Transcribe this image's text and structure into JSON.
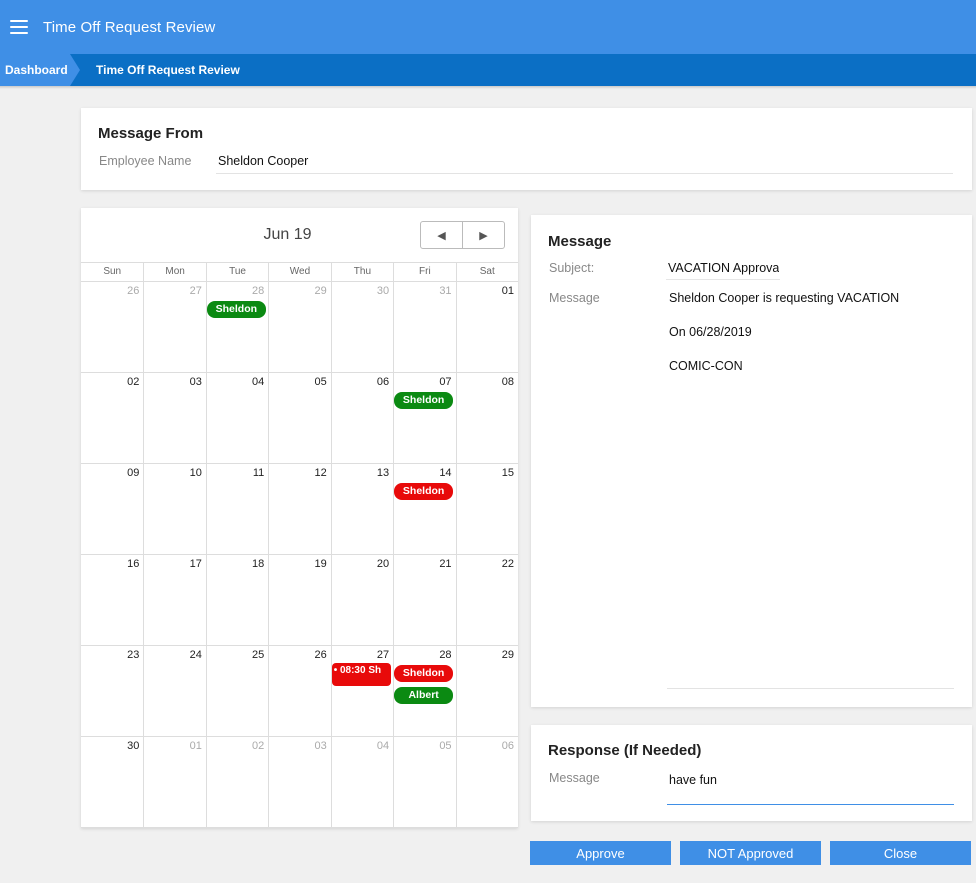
{
  "app": {
    "title": "Time Off Request Review"
  },
  "icons": {
    "menu": "hamburger-menu-icon",
    "prev": "triangle-left-icon",
    "next": "triangle-right-icon"
  },
  "colors": {
    "primary": "#3f8fe6",
    "breadcrumb": "#0b6fc5",
    "approved": "#0b8a12",
    "denied": "#e80a0a"
  },
  "breadcrumb": {
    "home": "Dashboard",
    "current": "Time Off Request Review"
  },
  "message_from": {
    "title": "Message From",
    "employee_label": "Employee Name",
    "employee_value": "Sheldon Cooper"
  },
  "calendar": {
    "title": "Jun 19",
    "weekdays": [
      "Sun",
      "Mon",
      "Tue",
      "Wed",
      "Thu",
      "Fri",
      "Sat"
    ],
    "days": [
      {
        "n": "26",
        "muted": true,
        "events": []
      },
      {
        "n": "27",
        "muted": true,
        "events": []
      },
      {
        "n": "28",
        "muted": true,
        "events": [
          {
            "label": "Sheldon",
            "color": "green"
          }
        ]
      },
      {
        "n": "29",
        "muted": true,
        "events": []
      },
      {
        "n": "30",
        "muted": true,
        "events": []
      },
      {
        "n": "31",
        "muted": true,
        "events": []
      },
      {
        "n": "01",
        "muted": false,
        "events": []
      },
      {
        "n": "02",
        "muted": false,
        "events": []
      },
      {
        "n": "03",
        "muted": false,
        "events": []
      },
      {
        "n": "04",
        "muted": false,
        "events": []
      },
      {
        "n": "05",
        "muted": false,
        "events": []
      },
      {
        "n": "06",
        "muted": false,
        "events": []
      },
      {
        "n": "07",
        "muted": false,
        "events": [
          {
            "label": "Sheldon",
            "color": "green"
          }
        ]
      },
      {
        "n": "08",
        "muted": false,
        "events": []
      },
      {
        "n": "09",
        "muted": false,
        "events": []
      },
      {
        "n": "10",
        "muted": false,
        "events": []
      },
      {
        "n": "11",
        "muted": false,
        "events": []
      },
      {
        "n": "12",
        "muted": false,
        "events": []
      },
      {
        "n": "13",
        "muted": false,
        "events": []
      },
      {
        "n": "14",
        "muted": false,
        "events": [
          {
            "label": "Sheldon",
            "color": "red"
          }
        ]
      },
      {
        "n": "15",
        "muted": false,
        "events": []
      },
      {
        "n": "16",
        "muted": false,
        "events": []
      },
      {
        "n": "17",
        "muted": false,
        "events": []
      },
      {
        "n": "18",
        "muted": false,
        "events": []
      },
      {
        "n": "19",
        "muted": false,
        "events": []
      },
      {
        "n": "20",
        "muted": false,
        "events": []
      },
      {
        "n": "21",
        "muted": false,
        "events": []
      },
      {
        "n": "22",
        "muted": false,
        "events": []
      },
      {
        "n": "23",
        "muted": false,
        "events": []
      },
      {
        "n": "24",
        "muted": false,
        "events": []
      },
      {
        "n": "25",
        "muted": false,
        "events": []
      },
      {
        "n": "26",
        "muted": false,
        "events": []
      },
      {
        "n": "27",
        "muted": false,
        "events": [
          {
            "label": "• 08:30 Sh",
            "color": "red",
            "timed": true
          }
        ]
      },
      {
        "n": "28",
        "muted": false,
        "events": [
          {
            "label": "Sheldon",
            "color": "red"
          },
          {
            "label": "Albert",
            "color": "green"
          }
        ]
      },
      {
        "n": "29",
        "muted": false,
        "events": []
      },
      {
        "n": "30",
        "muted": false,
        "events": []
      },
      {
        "n": "01",
        "muted": true,
        "events": []
      },
      {
        "n": "02",
        "muted": true,
        "events": []
      },
      {
        "n": "03",
        "muted": true,
        "events": []
      },
      {
        "n": "04",
        "muted": true,
        "events": []
      },
      {
        "n": "05",
        "muted": true,
        "events": []
      },
      {
        "n": "06",
        "muted": true,
        "events": []
      }
    ]
  },
  "message": {
    "title": "Message",
    "subject_label": "Subject:",
    "subject_value": "VACATION Approval",
    "message_label": "Message",
    "lines": [
      "Sheldon Cooper is requesting VACATION",
      "On 06/28/2019",
      "COMIC-CON"
    ]
  },
  "response": {
    "title": "Response (If Needed)",
    "message_label": "Message",
    "message_value": "have fun"
  },
  "buttons": {
    "approve": "Approve",
    "not_approved": "NOT Approved",
    "close": "Close"
  }
}
